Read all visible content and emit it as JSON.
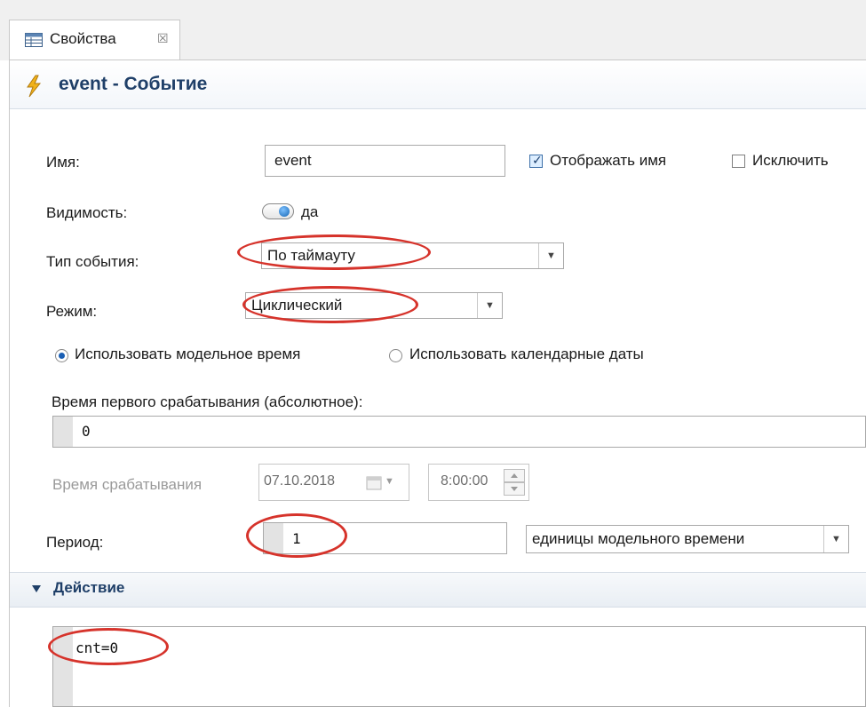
{
  "tab": {
    "label": "Свойства",
    "close_glyph": "☒"
  },
  "header": {
    "title": "event - Событие"
  },
  "name_row": {
    "label": "Имя:",
    "value": "event",
    "show_name_label": "Отображать имя",
    "show_name_checked": true,
    "exclude_label": "Исключить",
    "exclude_checked": false
  },
  "visibility_row": {
    "label": "Видимость:",
    "value": "да"
  },
  "event_type_row": {
    "label": "Тип события:",
    "value": "По таймауту"
  },
  "mode_row": {
    "label": "Режим:",
    "value": "Циклический"
  },
  "time_mode": {
    "model_time_label": "Использовать модельное время",
    "calendar_label": "Использовать календарные даты",
    "selected": "model_time"
  },
  "first_time": {
    "label": "Время первого срабатывания (абсолютное):",
    "value": "0"
  },
  "trigger_time": {
    "label": "Время срабатывания",
    "date": "07.10.2018",
    "time": "8:00:00"
  },
  "period_row": {
    "label": "Период:",
    "value": "1",
    "units": "единицы модельного времени"
  },
  "action_section": {
    "title": "Действие",
    "code": "cnt=0"
  },
  "colors": {
    "header_text": "#1f3f68",
    "annotation": "#d6332b",
    "radio_selected": "#1a5fb4"
  }
}
